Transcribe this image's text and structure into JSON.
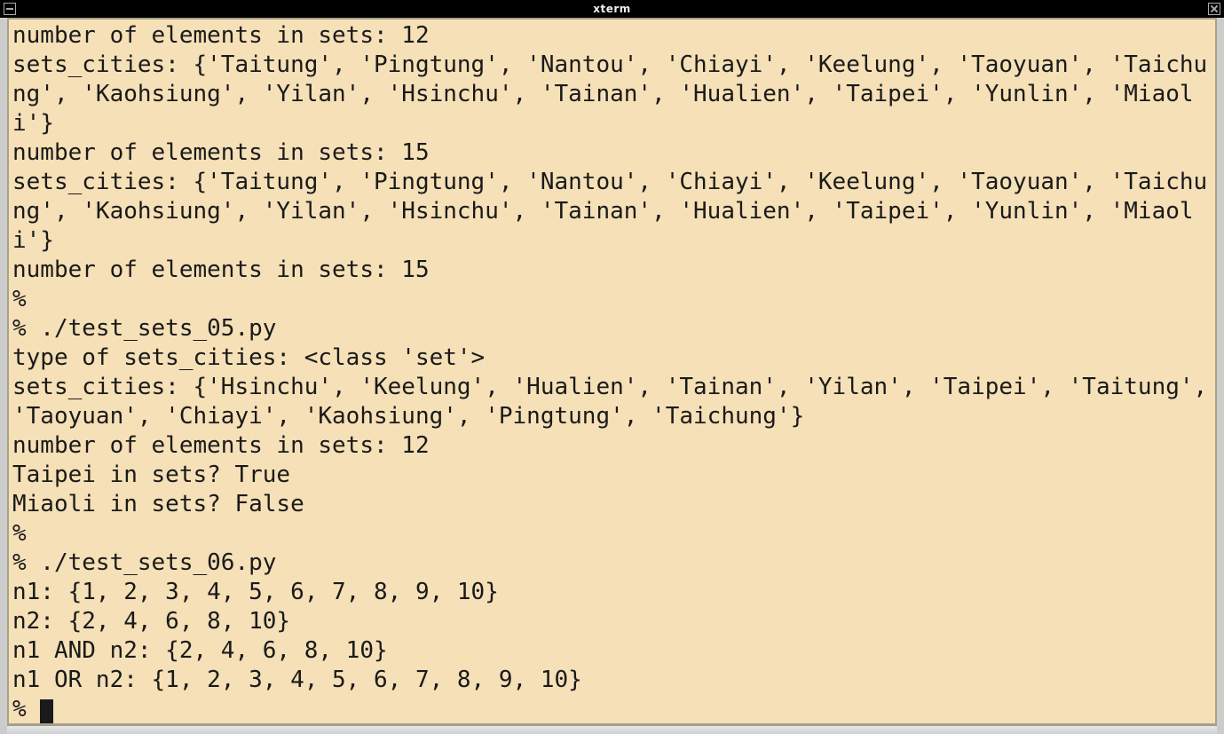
{
  "window": {
    "title": "xterm"
  },
  "terminal": {
    "lines": [
      "number of elements in sets: 12",
      "sets_cities: {'Taitung', 'Pingtung', 'Nantou', 'Chiayi', 'Keelung', 'Taoyuan', 'Taichung', 'Kaohsiung', 'Yilan', 'Hsinchu', 'Tainan', 'Hualien', 'Taipei', 'Yunlin', 'Miaoli'}",
      "number of elements in sets: 15",
      "sets_cities: {'Taitung', 'Pingtung', 'Nantou', 'Chiayi', 'Keelung', 'Taoyuan', 'Taichung', 'Kaohsiung', 'Yilan', 'Hsinchu', 'Tainan', 'Hualien', 'Taipei', 'Yunlin', 'Miaoli'}",
      "number of elements in sets: 15",
      "%",
      "% ./test_sets_05.py",
      "type of sets_cities: <class 'set'>",
      "sets_cities: {'Hsinchu', 'Keelung', 'Hualien', 'Tainan', 'Yilan', 'Taipei', 'Taitung', 'Taoyuan', 'Chiayi', 'Kaohsiung', 'Pingtung', 'Taichung'}",
      "number of elements in sets: 12",
      "Taipei in sets? True",
      "Miaoli in sets? False",
      "%",
      "% ./test_sets_06.py",
      "n1: {1, 2, 3, 4, 5, 6, 7, 8, 9, 10}",
      "n2: {2, 4, 6, 8, 10}",
      "n1 AND n2: {2, 4, 6, 8, 10}",
      "n1 OR n2: {1, 2, 3, 4, 5, 6, 7, 8, 9, 10}"
    ],
    "prompt": "% "
  }
}
